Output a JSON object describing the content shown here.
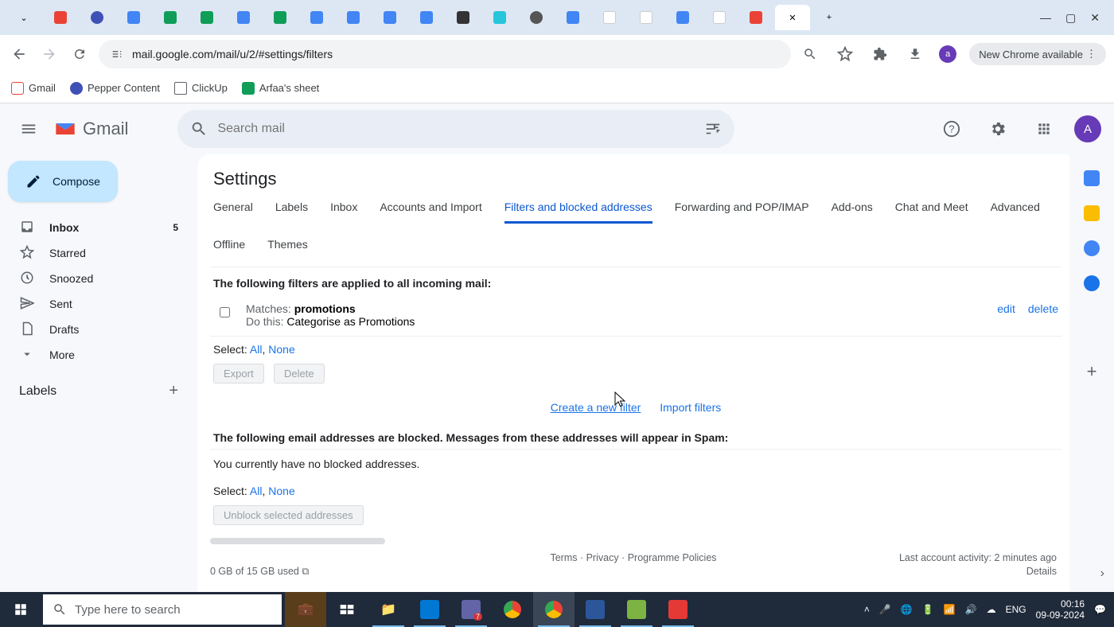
{
  "browser": {
    "url": "mail.google.com/mail/u/2/#settings/filters",
    "new_chrome_label": "New Chrome available",
    "profile_initial": "a",
    "window_controls": {
      "min": "—",
      "max": "▢",
      "close": "✕"
    },
    "tab_dropdown": "⌄",
    "tabs_count": 20,
    "new_tab": "+",
    "active_tab_close": "✕"
  },
  "bookmarks": [
    {
      "label": "Gmail",
      "color": "#ea4335"
    },
    {
      "label": "Pepper Content",
      "color": "#3f51b5"
    },
    {
      "label": "ClickUp",
      "color": "#ffffff"
    },
    {
      "label": "Arfaa's sheet",
      "color": "#0f9d58"
    }
  ],
  "gmail": {
    "brand": "Gmail",
    "search_placeholder": "Search mail",
    "compose": "Compose",
    "avatar_initial": "A",
    "nav": [
      {
        "icon": "inbox",
        "label": "Inbox",
        "count": "5",
        "active": true
      },
      {
        "icon": "star",
        "label": "Starred"
      },
      {
        "icon": "clock",
        "label": "Snoozed"
      },
      {
        "icon": "send",
        "label": "Sent"
      },
      {
        "icon": "draft",
        "label": "Drafts"
      },
      {
        "icon": "more",
        "label": "More"
      }
    ],
    "labels_header": "Labels"
  },
  "settings": {
    "title": "Settings",
    "tabs": [
      "General",
      "Labels",
      "Inbox",
      "Accounts and Import",
      "Filters and blocked addresses",
      "Forwarding and POP/IMAP",
      "Add-ons",
      "Chat and Meet",
      "Advanced",
      "Offline",
      "Themes"
    ],
    "active_tab": "Filters and blocked addresses",
    "filters_header": "The following filters are applied to all incoming mail:",
    "filter": {
      "matches_label": "Matches: ",
      "matches_value": "promotions",
      "dothis_label": "Do this: ",
      "dothis_value": "Categorise as Promotions",
      "edit": "edit",
      "delete": "delete"
    },
    "select_label": "Select: ",
    "select_all": "All",
    "select_none": "None",
    "export_btn": "Export",
    "delete_btn": "Delete",
    "create_filter": "Create a new filter",
    "import_filters": "Import filters",
    "blocked_header": "The following email addresses are blocked. Messages from these addresses will appear in Spam:",
    "no_blocked": "You currently have no blocked addresses.",
    "unblock_btn": "Unblock selected addresses",
    "storage": "0 GB of 15 GB used",
    "footer_links": {
      "terms": "Terms",
      "privacy": "Privacy",
      "policies": "Programme Policies"
    },
    "activity": "Last account activity: 2 minutes ago",
    "details": "Details"
  },
  "taskbar": {
    "search_placeholder": "Type here to search",
    "lang": "ENG",
    "time": "00:16",
    "date": "09-09-2024"
  }
}
